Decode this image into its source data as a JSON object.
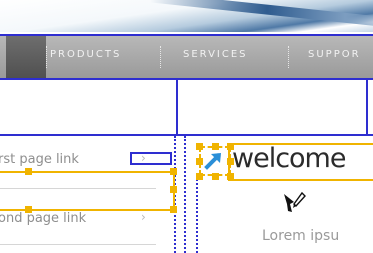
{
  "nav": {
    "items": [
      "PRODUCTS",
      "SERVICES",
      "SUPPOR"
    ]
  },
  "sidebar": {
    "links": [
      {
        "label": "rst page link",
        "chevron": "›"
      },
      {
        "label": "ond page link",
        "chevron": "›"
      }
    ]
  },
  "content": {
    "heading": "welcome",
    "body": "Lorem ipsu"
  },
  "colors": {
    "guide_blue": "#2e2ed0",
    "selection_yellow": "#f0b400",
    "nav_gray": "#a8a8a8",
    "arrow_blue": "#2a8fd8"
  },
  "icons": {
    "arrow": "arrow-up-right-icon",
    "cursor": "pen-cursor-icon"
  }
}
